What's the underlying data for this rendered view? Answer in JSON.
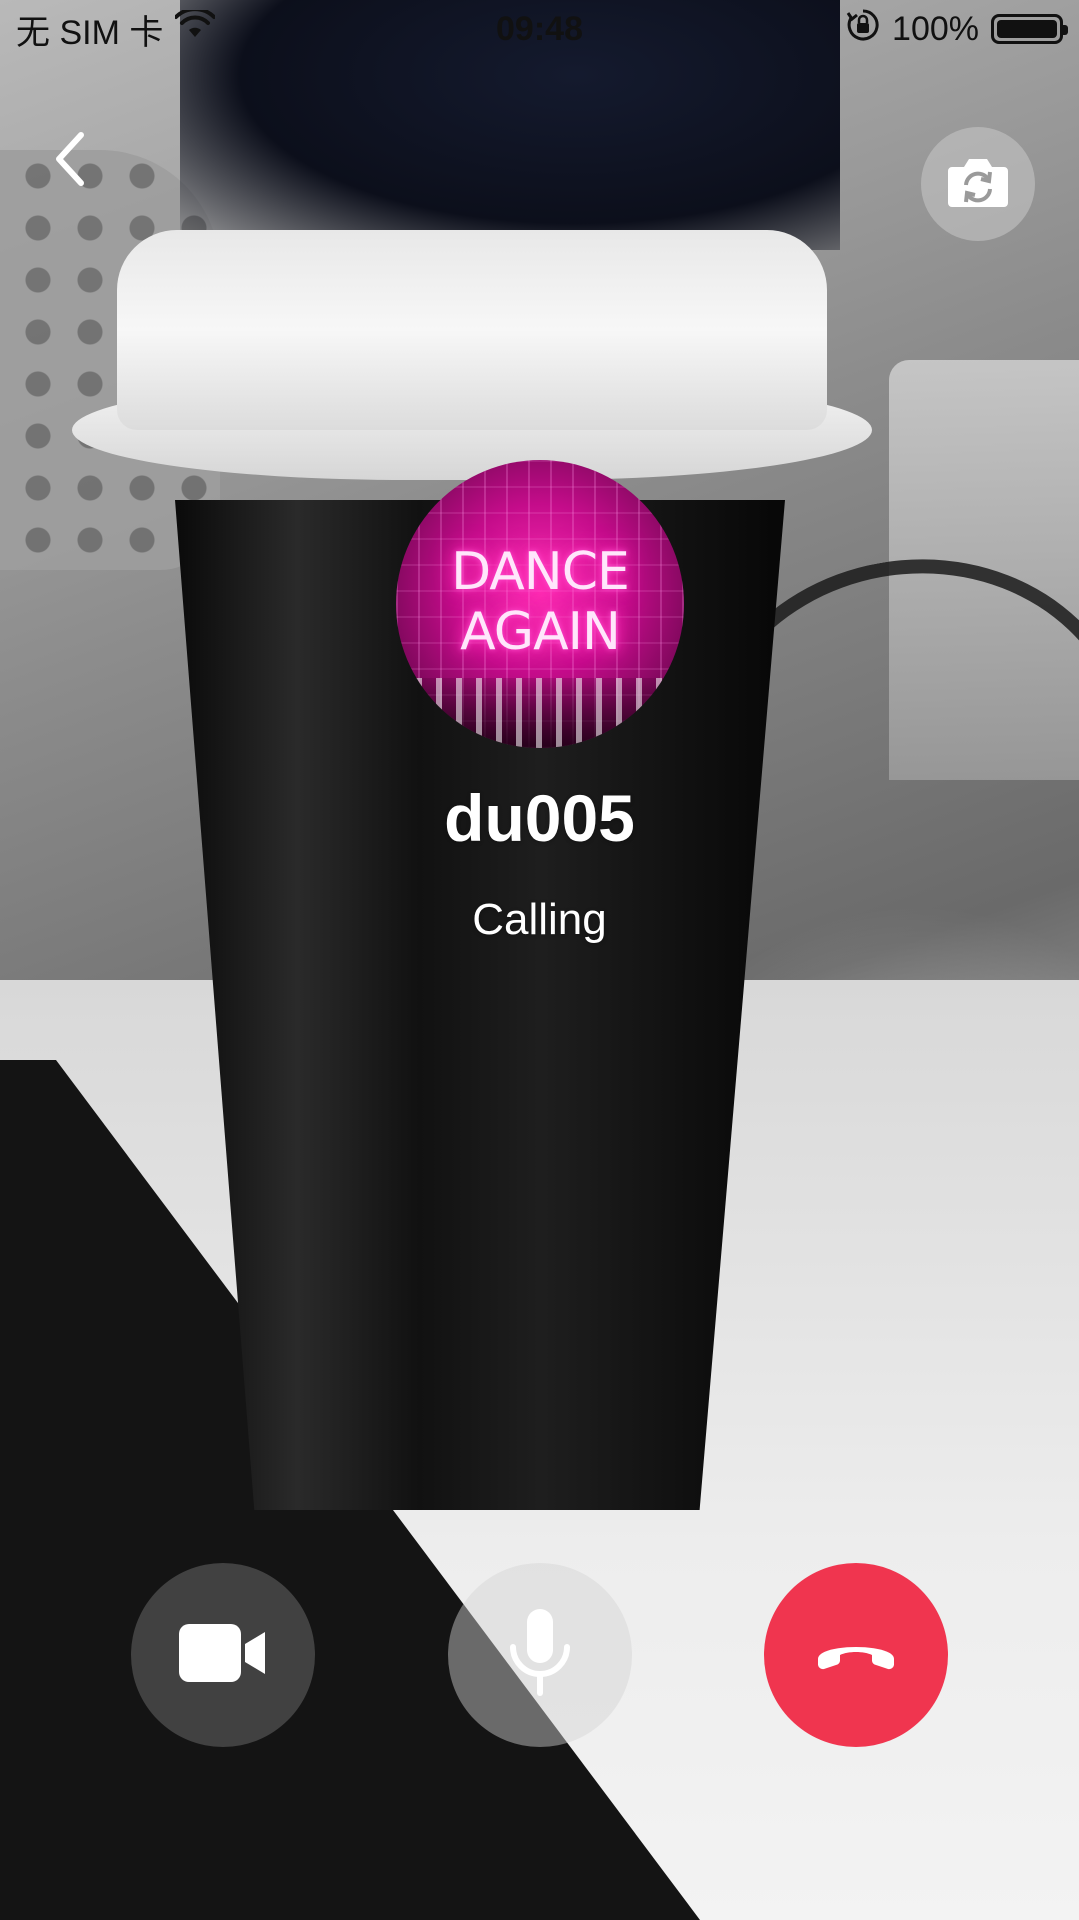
{
  "status_bar": {
    "carrier": "无 SIM 卡",
    "time": "09:48",
    "battery_percent": "100%",
    "battery_level": 1.0,
    "icons": [
      "wifi-icon",
      "orientation-lock-icon",
      "battery-icon"
    ]
  },
  "header": {
    "back_icon": "chevron-left-icon",
    "switch_camera_icon": "camera-switch-icon"
  },
  "caller": {
    "name": "du005",
    "status": "Calling",
    "avatar_text_line1": "DANCE",
    "avatar_text_line2": "AGAIN"
  },
  "controls": {
    "video_icon": "video-camera-icon",
    "mic_icon": "microphone-icon",
    "hangup_icon": "phone-hangup-icon"
  },
  "colors": {
    "hangup": "#f0354f",
    "avatar_neon": "#ff2fb4"
  }
}
